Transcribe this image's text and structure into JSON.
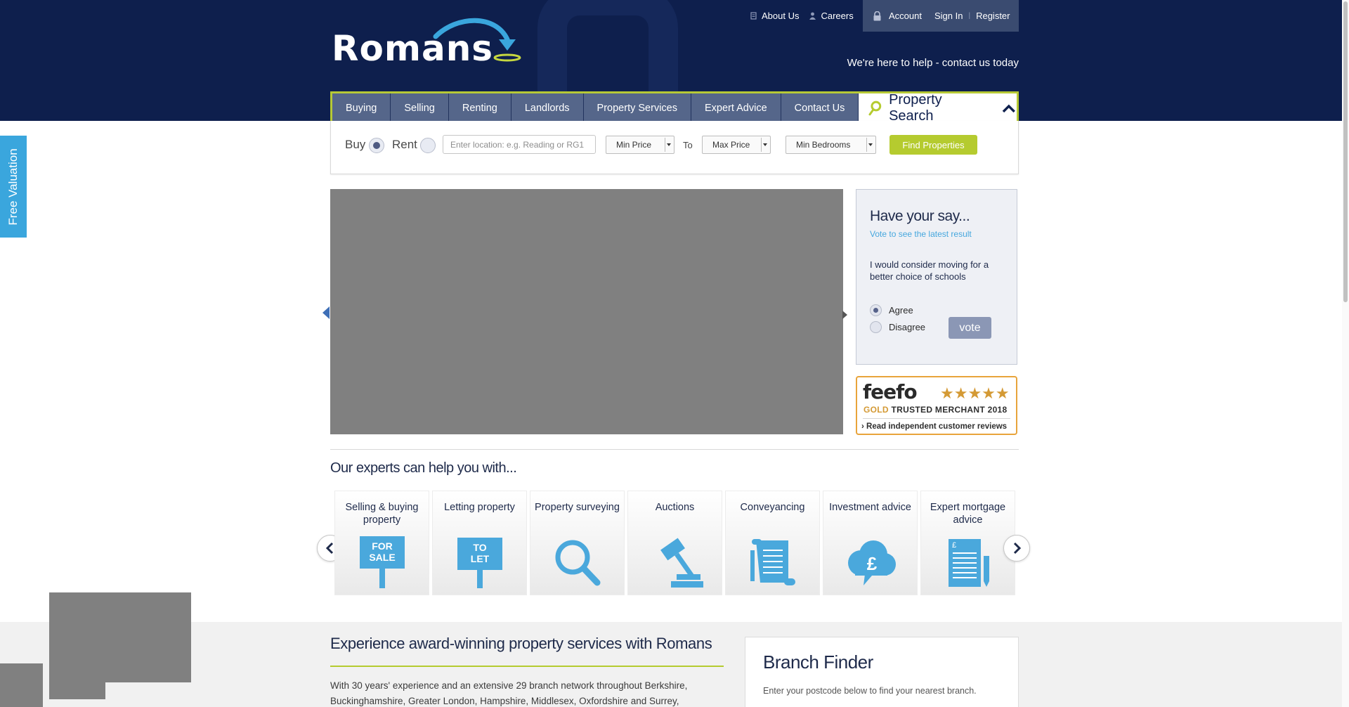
{
  "brand": {
    "logo_text": "Romans"
  },
  "top_links": {
    "about": "About Us",
    "careers": "Careers",
    "account": "Account",
    "sign_in": "Sign In",
    "separator": "|",
    "register": "Register"
  },
  "tagline": "We're here to help - contact us today",
  "nav": {
    "items": [
      "Buying",
      "Selling",
      "Renting",
      "Landlords",
      "Property Services",
      "Expert Advice",
      "Contact Us"
    ],
    "search_label": "Property Search"
  },
  "search": {
    "buy_label": "Buy",
    "rent_label": "Rent",
    "selected_mode": "Buy",
    "location_placeholder": "Enter location: e.g. Reading or RG1",
    "min_price": "Min Price",
    "to_label": "To",
    "max_price": "Max Price",
    "min_bedrooms": "Min Bedrooms",
    "find_button": "Find Properties"
  },
  "free_valuation": "Free Valuation",
  "poll": {
    "title": "Have your say...",
    "subtitle": "Vote to see the latest result",
    "question": "I would consider moving for a better choice of schools",
    "options": [
      "Agree",
      "Disagree"
    ],
    "selected": "Agree",
    "vote_button": "vote"
  },
  "feefo": {
    "brand": "feefo",
    "stars": "★★★★★",
    "rating": 5,
    "gold": "GOLD",
    "merchant": "TRUSTED MERCHANT 2018",
    "link": "Read independent customer reviews"
  },
  "experts": {
    "title": "Our experts can help you with...",
    "services": [
      {
        "label": "Selling & buying property",
        "icon": "for-sale-sign-icon",
        "sign": "FOR SALE"
      },
      {
        "label": "Letting property",
        "icon": "to-let-sign-icon",
        "sign": "TO LET"
      },
      {
        "label": "Property surveying",
        "icon": "magnifier-icon"
      },
      {
        "label": "Auctions",
        "icon": "gavel-icon"
      },
      {
        "label": "Conveyancing",
        "icon": "scroll-document-icon"
      },
      {
        "label": "Investment advice",
        "icon": "pound-cloud-icon",
        "symbol": "£"
      },
      {
        "label": "Expert mortgage advice",
        "icon": "mortgage-document-icon",
        "symbol": "£"
      }
    ]
  },
  "award": {
    "title": "Experience award-winning property services with Romans",
    "body": "With 30 years' experience and an extensive 29 branch network throughout Berkshire, Buckinghamshire, Greater London, Hampshire, Middlesex, Oxfordshire and Surrey,"
  },
  "branch_finder": {
    "title": "Branch Finder",
    "text": "Enter your postcode below to find your nearest branch."
  },
  "colors": {
    "header_bg": "#0e1f4d",
    "accent_green": "#b5cb2f",
    "accent_blue": "#3aa6dd",
    "icon_blue": "#4aa8dc",
    "star_gold": "#d49a35"
  }
}
